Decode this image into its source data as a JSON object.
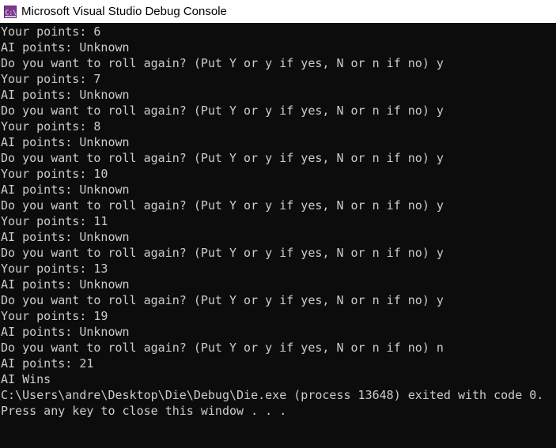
{
  "window": {
    "title": "Microsoft Visual Studio Debug Console",
    "icon": "visual-studio-console-icon",
    "colors": {
      "titlebar_bg": "#ffffff",
      "console_bg": "#0c0c0c",
      "console_text": "#cccccc",
      "icon_purple": "#68217a"
    }
  },
  "console": {
    "lines": [
      "Your points: 6",
      "AI points: Unknown",
      "Do you want to roll again? (Put Y or y if yes, N or n if no) y",
      "Your points: 7",
      "AI points: Unknown",
      "Do you want to roll again? (Put Y or y if yes, N or n if no) y",
      "Your points: 8",
      "AI points: Unknown",
      "Do you want to roll again? (Put Y or y if yes, N or n if no) y",
      "Your points: 10",
      "AI points: Unknown",
      "Do you want to roll again? (Put Y or y if yes, N or n if no) y",
      "Your points: 11",
      "AI points: Unknown",
      "Do you want to roll again? (Put Y or y if yes, N or n if no) y",
      "Your points: 13",
      "AI points: Unknown",
      "Do you want to roll again? (Put Y or y if yes, N or n if no) y",
      "Your points: 19",
      "AI points: Unknown",
      "Do you want to roll again? (Put Y or y if yes, N or n if no) n",
      "AI points: 21",
      "AI Wins",
      "C:\\Users\\andre\\Desktop\\Die\\Debug\\Die.exe (process 13648) exited with code 0.",
      "Press any key to close this window . . ."
    ]
  }
}
